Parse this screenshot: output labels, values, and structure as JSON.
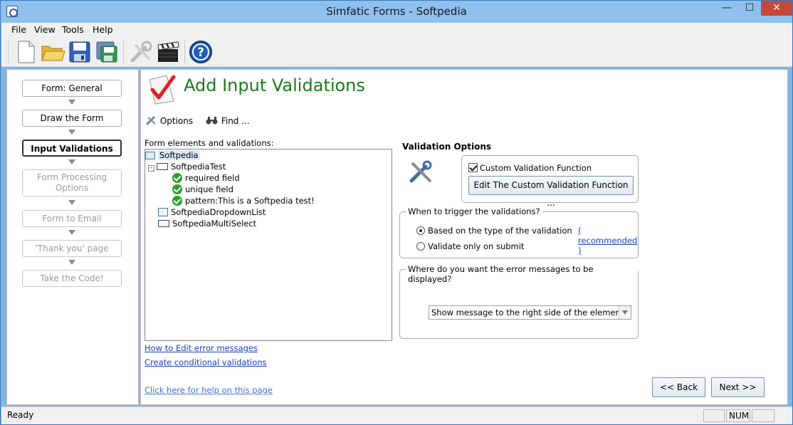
{
  "window": {
    "title": "Simfatic Forms - Softpedia",
    "minimize_glyph": "—",
    "maximize_glyph": "☐",
    "close_glyph": "✕"
  },
  "menu": [
    "File",
    "View",
    "Tools",
    "Help"
  ],
  "toolbar": {
    "icons": [
      "new-document-icon",
      "open-folder-icon",
      "save-icon",
      "save-as-icon",
      "build-tools-icon",
      "clapperboard-icon",
      "help-icon"
    ]
  },
  "steps": [
    {
      "label": "Form: General",
      "state": "normal"
    },
    {
      "label": "Draw the Form",
      "state": "normal"
    },
    {
      "label": "Input Validations",
      "state": "active"
    },
    {
      "label": "Form Processing Options",
      "state": "disabled"
    },
    {
      "label": "Form to Email",
      "state": "disabled"
    },
    {
      "label": "'Thank you' page",
      "state": "disabled"
    },
    {
      "label": "Take the Code!",
      "state": "disabled"
    }
  ],
  "page": {
    "title": "Add Input Validations",
    "options_label": "Options",
    "find_label": "Find ...",
    "tree_label": "Form elements and validations:",
    "tree": {
      "root": "Softpedia",
      "field": "SoftpediaTest",
      "validations": [
        "required field",
        "unique field",
        "pattern:This is a Softpedia test!"
      ],
      "other_fields": [
        "SoftpediaDropdownList",
        "SoftpediaMultiSelect"
      ]
    },
    "links": {
      "edit_errors": "How to Edit error messages",
      "conditional": "Create conditional validations",
      "help": "Click here for help on this page"
    }
  },
  "validation_options": {
    "title": "Validation Options",
    "custom_checkbox": "Custom Validation Function",
    "custom_checked": true,
    "edit_button": "Edit The Custom Validation Function ...",
    "trigger_legend": "When to trigger the validations?",
    "trigger_option_1": "Based on the type of the validation",
    "trigger_option_2": "Validate only on submit",
    "recommended_link": "( recommended )",
    "selected_trigger": 1,
    "error_legend": "Where do you want the error messages to be displayed?",
    "error_select_value": "Show message to the right side of the element"
  },
  "nav": {
    "back": "<< Back",
    "next": "Next >>"
  },
  "status": {
    "text": "Ready",
    "num": "NUM"
  }
}
